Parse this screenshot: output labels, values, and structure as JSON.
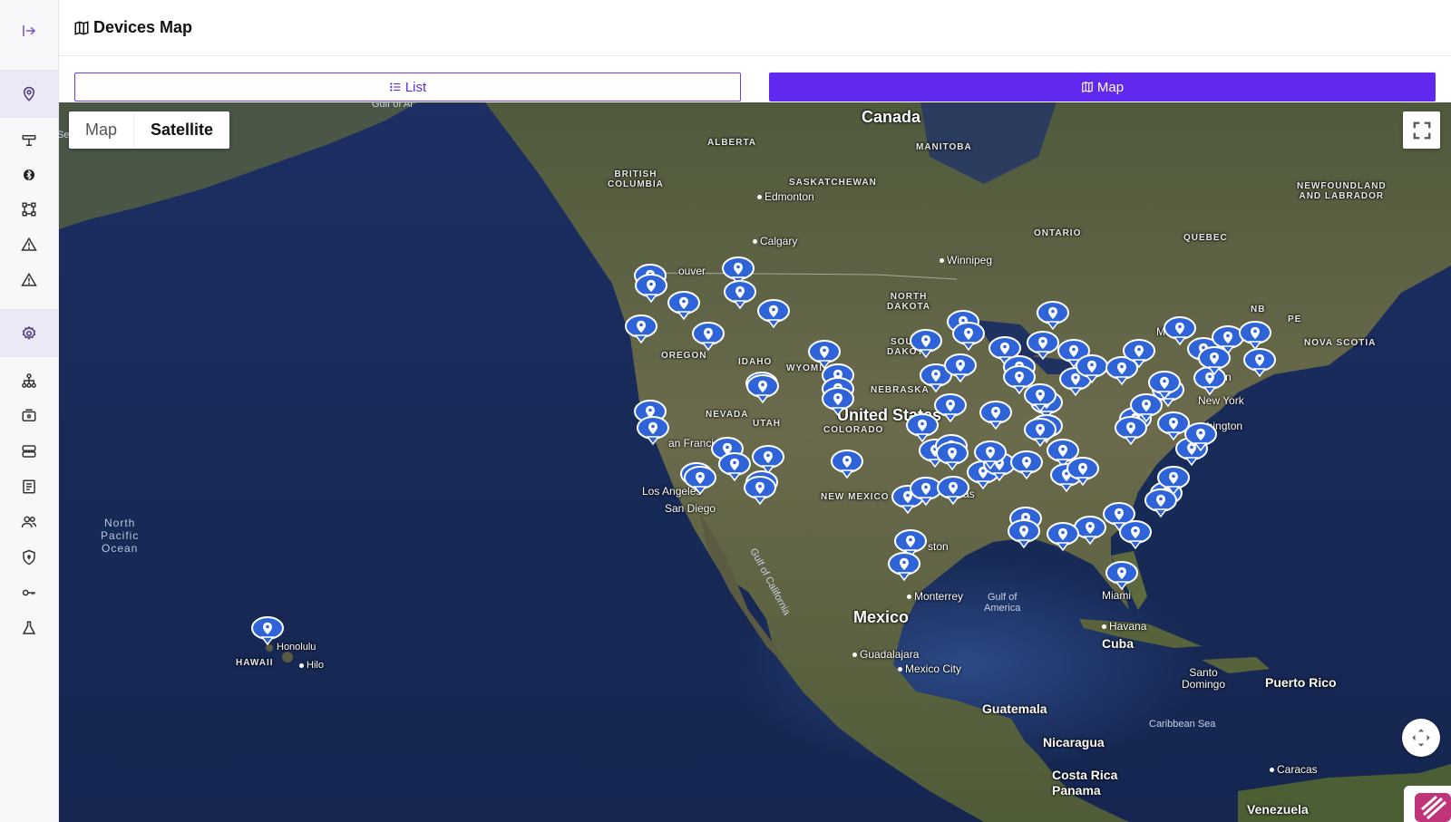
{
  "sidebar": {
    "collapse_icon": "expand-right-icon",
    "items": [
      {
        "icon": "map-pin-icon",
        "name": "sidebar-item-devices-map",
        "active": true
      },
      {
        "icon": "sliders-icon",
        "name": "sidebar-item-controls"
      },
      {
        "icon": "bluetooth-icon",
        "name": "sidebar-item-bluetooth"
      },
      {
        "icon": "topology-icon",
        "name": "sidebar-item-topology"
      },
      {
        "icon": "warning-icon",
        "name": "sidebar-item-alerts"
      },
      {
        "icon": "warning-icon",
        "name": "sidebar-item-alarms"
      },
      {
        "icon": "settings-icon",
        "name": "sidebar-item-settings",
        "active": true
      },
      {
        "icon": "hierarchy-icon",
        "name": "sidebar-item-hierarchy"
      },
      {
        "icon": "device-icon",
        "name": "sidebar-item-devices"
      },
      {
        "icon": "server-icon",
        "name": "sidebar-item-servers"
      },
      {
        "icon": "report-icon",
        "name": "sidebar-item-reports"
      },
      {
        "icon": "users-icon",
        "name": "sidebar-item-users"
      },
      {
        "icon": "shield-icon",
        "name": "sidebar-item-security"
      },
      {
        "icon": "key-icon",
        "name": "sidebar-item-keys"
      },
      {
        "icon": "flask-icon",
        "name": "sidebar-item-lab"
      }
    ]
  },
  "header": {
    "title": "Devices Map",
    "icon": "map-icon"
  },
  "view_toggle": {
    "list_label": "List",
    "map_label": "Map",
    "selected": "Map"
  },
  "map": {
    "map_type": {
      "map_label": "Map",
      "satellite_label": "Satellite",
      "selected": "Satellite"
    },
    "labels": {
      "canada": "Canada",
      "united_states": "United States",
      "mexico": "Mexico",
      "cuba": "Cuba",
      "guatemala": "Guatemala",
      "nicaragua": "Nicaragua",
      "costa_rica": "Costa Rica",
      "panama": "Panama",
      "venezuela": "Venezuela",
      "puerto_rico": "Puerto Rico",
      "alberta": "ALBERTA",
      "british_columbia": "BRITISH\nCOLUMBIA",
      "saskatchewan": "SASKATCHEWAN",
      "manitoba": "MANITOBA",
      "ontario": "ONTARIO",
      "quebec": "QUEBEC",
      "newfoundland": "NEWFOUNDLAND\nAND LABRADOR",
      "nb": "NB",
      "pe": "PE",
      "nova_scotia": "NOVA SCOTIA",
      "north_dakota": "NORTH\nDAKOTA",
      "south_dakota": "SOUTH\nDAKOTA",
      "nebraska": "NEBRASKA",
      "oregon": "OREGON",
      "idaho": "IDAHO",
      "nevada": "NEVADA",
      "utah": "UTAH",
      "colorado": "COLORADO",
      "new_mexico": "NEW MEXICO",
      "wyoming": "WYOMI",
      "edmonton": "Edmonton",
      "calgary": "Calgary",
      "winnipeg": "Winnipeg",
      "vancouver": "ouver",
      "san_francisco": "an Francis",
      "los_angeles": "Los Angeles",
      "san_diego": "San Diego",
      "dallas": "allas",
      "houston": "ston",
      "miami": "Miami",
      "havana": "Havana",
      "monterrey": "Monterrey",
      "guadalajara": "Guadalajara",
      "mexico_city": "Mexico City",
      "boston": "ston",
      "new_york": "New York",
      "washington": "ashington",
      "montreal": "Montre",
      "santo_domingo": "Santo\nDomingo",
      "caracas": "Caracas",
      "honolulu": "Honolulu",
      "hilo": "Hilo",
      "hawaii": "HAWAII",
      "north_pacific": "North\nPacific\nOcean",
      "gulf_of_mexico": "Gulf of\nAmerica",
      "gulf_of_california": "Gulf of California",
      "caribbean": "Caribbean Sea",
      "gulf_of_alaska": "Gulf of Al",
      "sea": "Se"
    }
  }
}
